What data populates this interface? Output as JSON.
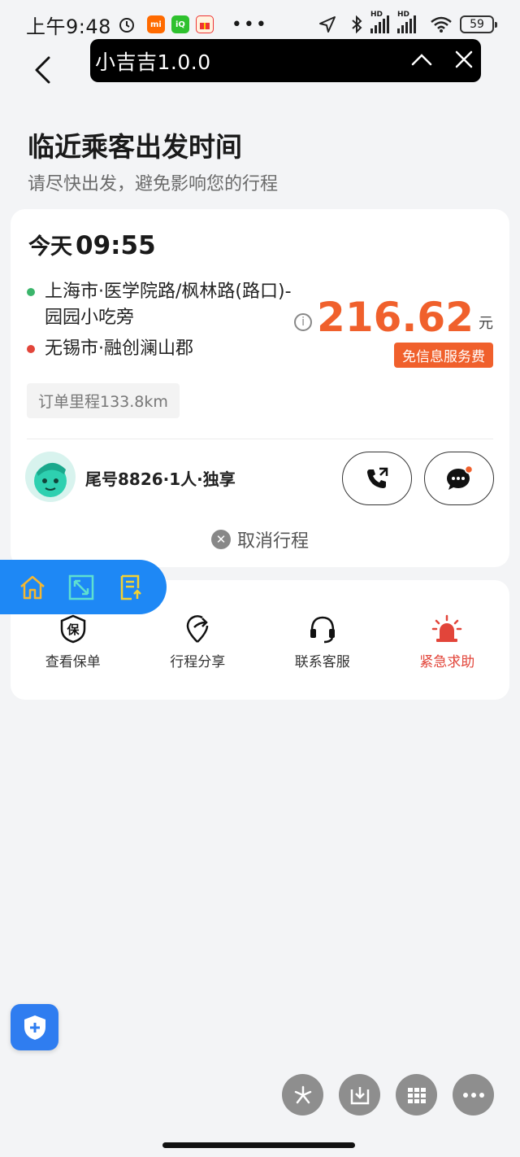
{
  "status_bar": {
    "time": "上午9:48",
    "battery": "59",
    "icons": [
      "alarm-icon",
      "mi-app-icon",
      "iqiyi-app-icon",
      "gift-app-icon",
      "more-dots-icon",
      "location-arrow-icon",
      "bluetooth-icon",
      "signal-hd-icon",
      "signal-hd-icon",
      "wifi-icon",
      "battery-icon"
    ],
    "hd_label": "HD"
  },
  "mini_program": {
    "title": "小吉吉1.0.0"
  },
  "header": {
    "title": "临近乘客出发时间",
    "subtitle": "请尽快出发，避免影响您的行程"
  },
  "trip": {
    "depart_day": "今天",
    "depart_time": "09:55",
    "origin": "上海市·医学院路/枫林路(路口)-园园小吃旁",
    "destination": "无锡市·融创澜山郡",
    "fare_amount": "216.62",
    "fare_unit": "元",
    "fare_badge": "免信息服务费",
    "distance": "订单里程133.8km",
    "passenger": "尾号8826·1人·独享",
    "cancel_label": "取消行程",
    "colors": {
      "accent": "#f0602c",
      "origin_dot": "#3bb56b",
      "dest_dot": "#e2453a"
    }
  },
  "actions": [
    {
      "label": "查看保单",
      "icon": "insurance-icon"
    },
    {
      "label": "行程分享",
      "icon": "share-trip-icon"
    },
    {
      "label": "联系客服",
      "icon": "headset-icon"
    },
    {
      "label": "紧急求助",
      "icon": "siren-icon"
    }
  ],
  "insurance_glyph": "保",
  "floating_nav": {
    "color": "#1e88f5",
    "icons": [
      "home-icon",
      "resize-icon",
      "upload-note-icon"
    ]
  },
  "bottom_tools": [
    "pinwheel-icon",
    "download-icon",
    "grid-icon",
    "more-icon"
  ]
}
